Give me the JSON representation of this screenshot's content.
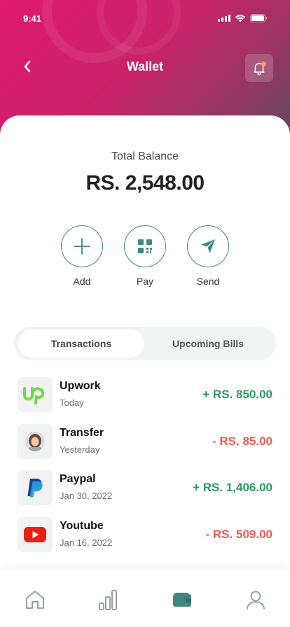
{
  "status_bar": {
    "time": "9:41"
  },
  "header": {
    "title": "Wallet"
  },
  "balance": {
    "label": "Total Balance",
    "amount": "RS. 2,548.00"
  },
  "actions": [
    {
      "label": "Add",
      "icon": "plus-icon"
    },
    {
      "label": "Pay",
      "icon": "qr-code-icon"
    },
    {
      "label": "Send",
      "icon": "send-icon"
    }
  ],
  "tabs": [
    {
      "label": "Transactions",
      "active": true
    },
    {
      "label": "Upcoming Bills",
      "active": false
    }
  ],
  "transactions": [
    {
      "name": "Upwork",
      "date": "Today",
      "amount": "+ RS. 850.00",
      "type": "credit",
      "icon": "upwork-logo-icon"
    },
    {
      "name": "Transfer",
      "date": "Yesterday",
      "amount": "- RS. 85.00",
      "type": "debit",
      "icon": "person-avatar"
    },
    {
      "name": "Paypal",
      "date": "Jan 30, 2022",
      "amount": "+ RS. 1,406.00",
      "type": "credit",
      "icon": "paypal-logo-icon"
    },
    {
      "name": "Youtube",
      "date": "Jan 16, 2022",
      "amount": "- RS. 509.00",
      "type": "debit",
      "icon": "youtube-logo-icon"
    }
  ],
  "bottom_nav": [
    {
      "icon": "home-icon",
      "active": false
    },
    {
      "icon": "bar-chart-icon",
      "active": false
    },
    {
      "icon": "wallet-icon",
      "active": true
    },
    {
      "icon": "profile-icon",
      "active": false
    }
  ],
  "colors": {
    "accent": "#408782",
    "header_gradient_start": "#e0196f",
    "header_gradient_end": "#4d5160",
    "credit": "#2d9a5f",
    "debit": "#ec5a4f",
    "notification_dot": "#f59a5c"
  }
}
